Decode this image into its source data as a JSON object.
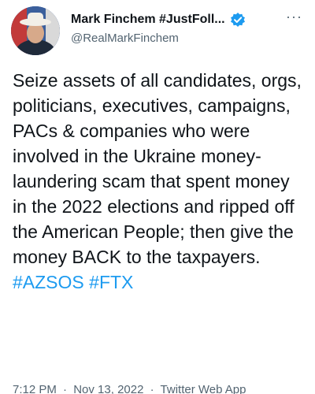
{
  "author": {
    "display_name": "Mark Finchem #JustFoll...",
    "handle": "@RealMarkFinchem",
    "verified_icon": "verified-badge-icon",
    "more_icon": "more-dots-icon",
    "more_label": "···"
  },
  "tweet": {
    "text": "Seize assets of all candidates, orgs, politicians, executives, campaigns, PACs & companies who were involved in the Ukraine money-laundering scam that spent money in the 2022 elections and ripped off the American People; then give the money BACK to the taxpayers.",
    "hashtags": [
      "#AZSOS",
      "#FTX"
    ]
  },
  "meta": {
    "time": "7:12 PM",
    "separator": "·",
    "date": "Nov 13, 2022",
    "source": "Twitter Web App"
  },
  "colors": {
    "accent": "#1d9bf0",
    "text": "#0f1419",
    "secondary": "#536471"
  }
}
